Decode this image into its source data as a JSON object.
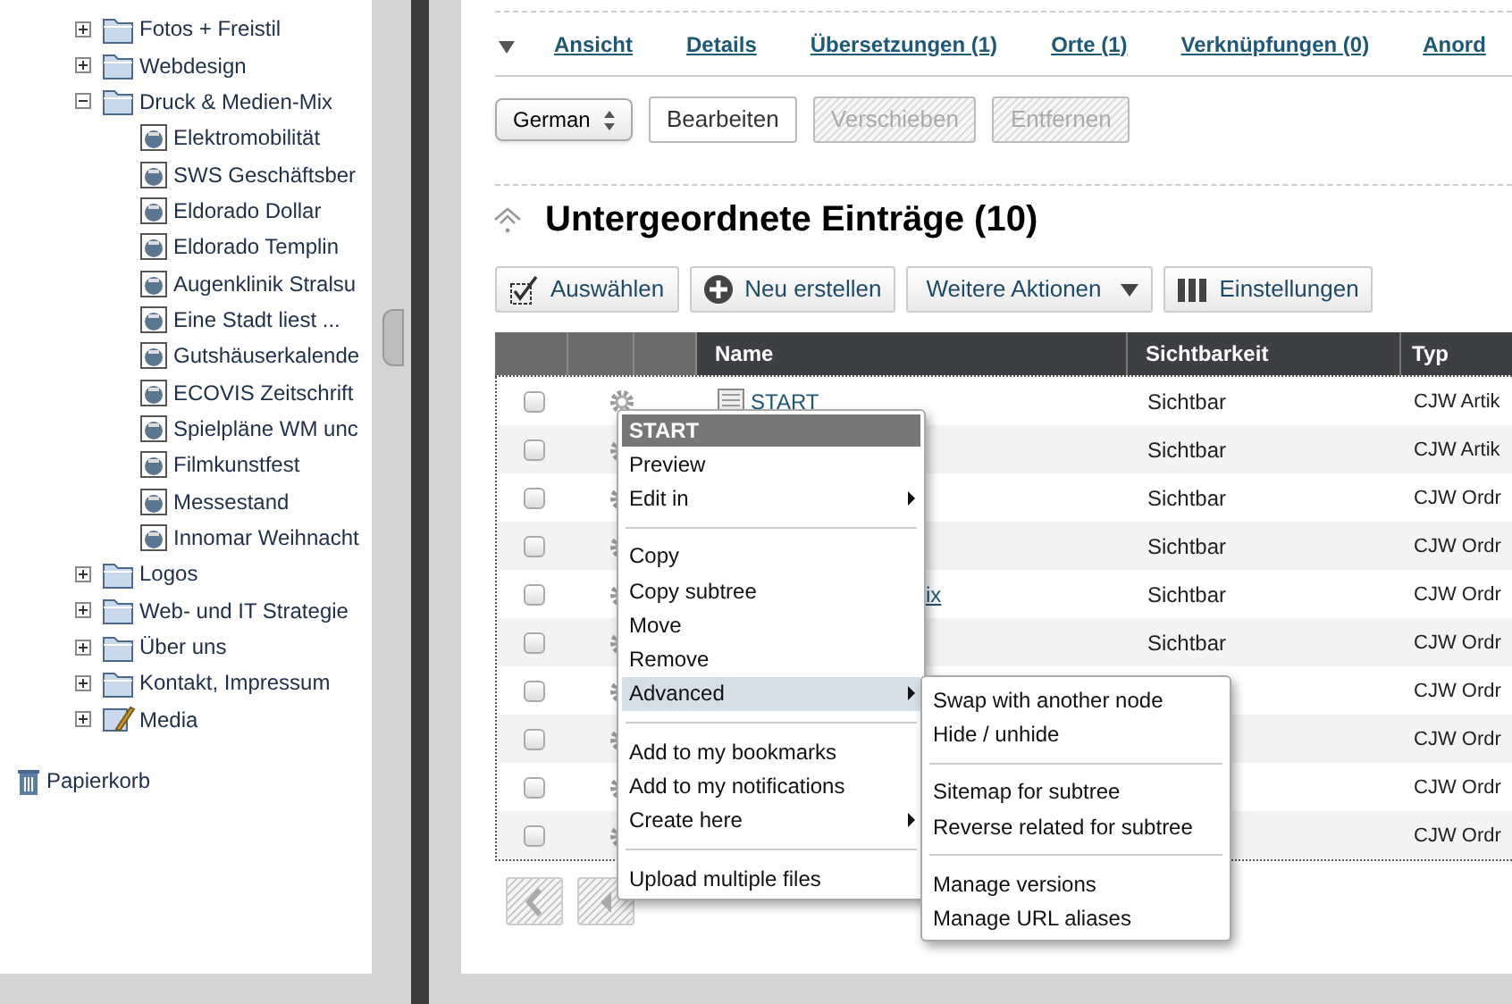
{
  "tree": [
    {
      "label": "Fotos + Freistil",
      "kind": "folder",
      "expanded": false
    },
    {
      "label": "Webdesign",
      "kind": "folder",
      "expanded": false
    },
    {
      "label": "Druck & Medien-Mix",
      "kind": "folder",
      "expanded": true,
      "children": [
        {
          "label": "Elektromobilität",
          "kind": "document"
        },
        {
          "label": "SWS Geschäftsber",
          "kind": "document"
        },
        {
          "label": "Eldorado Dollar",
          "kind": "document"
        },
        {
          "label": "Eldorado Templin",
          "kind": "document"
        },
        {
          "label": "Augenklinik Stralsu",
          "kind": "document"
        },
        {
          "label": "Eine Stadt liest ...",
          "kind": "document"
        },
        {
          "label": "Gutshäuserkalende",
          "kind": "document"
        },
        {
          "label": "ECOVIS Zeitschrift",
          "kind": "document"
        },
        {
          "label": "Spielpläne WM unc",
          "kind": "document"
        },
        {
          "label": "Filmkunstfest",
          "kind": "document"
        },
        {
          "label": "Messestand",
          "kind": "document"
        },
        {
          "label": "Innomar Weihnacht",
          "kind": "document"
        }
      ]
    },
    {
      "label": "Logos",
      "kind": "folder",
      "expanded": false
    },
    {
      "label": "Web- und IT Strategie",
      "kind": "folder",
      "expanded": false
    },
    {
      "label": "Über uns",
      "kind": "folder",
      "expanded": false
    },
    {
      "label": "Kontakt, Impressum",
      "kind": "folder",
      "expanded": false
    },
    {
      "label": "Media",
      "kind": "media",
      "expanded": false
    }
  ],
  "trash": "Papierkorb",
  "tabs": [
    {
      "label": "Ansicht"
    },
    {
      "label": "Details"
    },
    {
      "label": "Übersetzungen (1)"
    },
    {
      "label": "Orte (1)"
    },
    {
      "label": "Verknüpfungen (0)"
    },
    {
      "label": "Anord"
    }
  ],
  "language": "German",
  "actions": [
    {
      "label": "Bearbeiten",
      "disabled": false
    },
    {
      "label": "Verschieben",
      "disabled": true
    },
    {
      "label": "Entfernen",
      "disabled": true
    }
  ],
  "heading": "Untergeordnete Einträge (10)",
  "toolbar": [
    {
      "label": "Auswählen",
      "kind": "select"
    },
    {
      "label": "Neu erstellen",
      "kind": "create"
    },
    {
      "label": "Weitere Aktionen",
      "kind": "dropdown"
    },
    {
      "label": "Einstellungen",
      "kind": "columns"
    }
  ],
  "table": {
    "columns": [
      "Name",
      "Sichtbarkeit",
      "Typ"
    ],
    "rows": [
      {
        "checked": false,
        "name": "START",
        "kind": "document",
        "visibility": "Sichtbar",
        "type": "CJW Artik"
      },
      {
        "checked": false,
        "visibility": "Sichtbar",
        "type": "CJW Artik"
      },
      {
        "checked": false,
        "visibility": "Sichtbar",
        "type": "CJW Ordr"
      },
      {
        "checked": false,
        "visibility": "Sichtbar",
        "type": "CJW Ordr"
      },
      {
        "checked": false,
        "name": "ix",
        "kind": "covered",
        "visibility": "Sichtbar",
        "type": "CJW Ordr"
      },
      {
        "checked": false,
        "visibility": "Sichtbar",
        "type": "CJW Ordr"
      },
      {
        "checked": false,
        "type": "CJW Ordr"
      },
      {
        "checked": false,
        "type": "CJW Ordr"
      },
      {
        "checked": false,
        "type": "CJW Ordr"
      },
      {
        "checked": false,
        "type": "CJW Ordr"
      }
    ]
  },
  "pager": [
    {
      "kind": "first",
      "disabled": true
    },
    {
      "kind": "previous",
      "disabled": true
    }
  ],
  "context_menu": {
    "title": "START",
    "groups": [
      [
        {
          "label": "Preview",
          "submenu": false,
          "selected": false
        },
        {
          "label": "Edit in",
          "submenu": true,
          "selected": false
        }
      ],
      [
        {
          "label": "Copy",
          "submenu": false,
          "selected": false
        },
        {
          "label": "Copy subtree",
          "submenu": false,
          "selected": false
        },
        {
          "label": "Move",
          "submenu": false,
          "selected": false
        },
        {
          "label": "Remove",
          "submenu": false,
          "selected": false
        },
        {
          "label": "Advanced",
          "submenu": true,
          "selected": true
        }
      ],
      [
        {
          "label": "Add to my bookmarks",
          "submenu": false,
          "selected": false
        },
        {
          "label": "Add to my notifications",
          "submenu": false,
          "selected": false
        },
        {
          "label": "Create here",
          "submenu": true,
          "selected": false
        }
      ],
      [
        {
          "label": "Upload multiple files",
          "submenu": false,
          "selected": false
        }
      ]
    ]
  },
  "submenu": {
    "groups": [
      [
        "Swap with another node",
        "Hide / unhide"
      ],
      [
        "Sitemap for subtree",
        "Reverse related for subtree"
      ],
      [
        "Manage versions",
        "Manage URL aliases"
      ]
    ]
  }
}
